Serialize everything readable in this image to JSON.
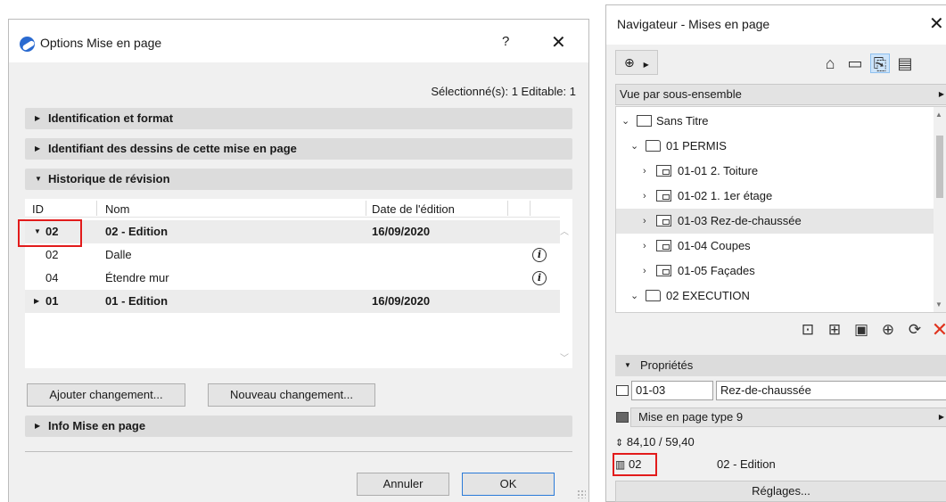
{
  "dialog": {
    "title": "Options Mise en page",
    "help": "?",
    "close": "✕",
    "selection_info": "Sélectionné(s): 1 Editable: 1",
    "sections": {
      "identification": "Identification et format",
      "drawing_ids": "Identifiant des dessins de cette mise en page",
      "revision_history": "Historique de révision",
      "info": "Info Mise en page"
    },
    "table": {
      "columns": [
        "ID",
        "Nom",
        "Date de l'édition"
      ],
      "rows": [
        {
          "id": "02",
          "name": "02 - Edition",
          "date": "16/09/2020"
        },
        {
          "id": "02",
          "name": "Dalle",
          "date": ""
        },
        {
          "id": "04",
          "name": "Étendre mur",
          "date": ""
        },
        {
          "id": "01",
          "name": "01 - Edition",
          "date": "16/09/2020"
        }
      ]
    },
    "buttons": {
      "add_change": "Ajouter changement...",
      "new_change": "Nouveau changement...",
      "cancel": "Annuler",
      "ok": "OK"
    }
  },
  "navigator": {
    "title": "Navigateur - Mises en page",
    "close": "✕",
    "view_select": "Vue par sous-ensemble",
    "tree": {
      "root": "Sans Titre",
      "subset1": "01 PERMIS",
      "items": [
        "01-01 2. Toiture",
        "01-02 1. 1er étage",
        "01-03 Rez-de-chaussée",
        "01-04 Coupes",
        "01-05 Façades"
      ],
      "subset2": "02 EXECUTION"
    },
    "properties": {
      "header": "Propriétés",
      "id": "01-03",
      "name": "Rez-de-chaussée",
      "master": "Mise en page type 9",
      "size": "84,10 / 59,40",
      "revision_id": "02",
      "revision_name": "02 - Edition",
      "settings": "Réglages..."
    }
  },
  "colors": {
    "highlight_red": "#e21b1b",
    "accent_blue": "#2a7ad8",
    "delete_red": "#e0341f"
  }
}
